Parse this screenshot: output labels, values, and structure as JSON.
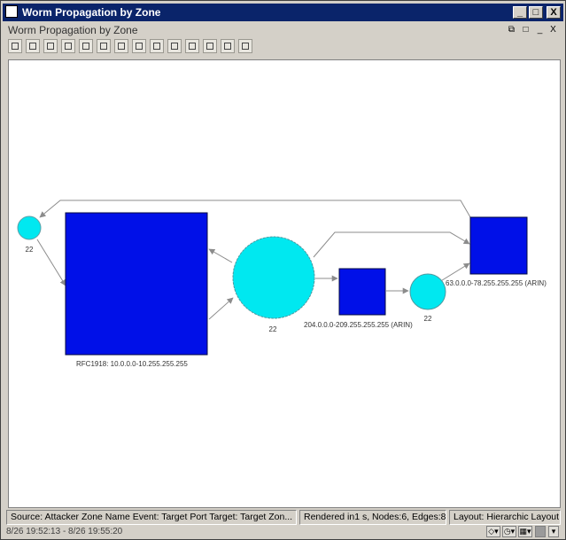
{
  "window": {
    "title": "Worm Propagation by Zone",
    "inner_title": "Worm Propagation by Zone",
    "minimize": "_",
    "maximize": "□",
    "close": "X"
  },
  "inner_controls": {
    "restore": "⧉",
    "max": "□",
    "min": "_",
    "close": "X"
  },
  "toolbar": {
    "icons": [
      "split-icon",
      "fit-icon",
      "zoom-in-icon",
      "zoom-out-icon",
      "layout-icon",
      "tree-icon",
      "radial-icon",
      "grid-icon",
      "hierarchy-icon",
      "export-icon",
      "image-icon",
      "print-icon",
      "stop-icon",
      "help-icon"
    ]
  },
  "graph": {
    "colors": {
      "zone": "#0010e8",
      "port": "#00e8f0",
      "edge": "#8c8c8c"
    },
    "labels": {
      "left_port": "22",
      "rfc1918": "RFC1918: 10.0.0.0-10.255.255.255",
      "center_port": "22",
      "arin204": "204.0.0.0-209.255.255.255 (ARIN)",
      "right_port": "22",
      "arin63": "63.0.0.0-78.255.255.255 (ARIN)"
    }
  },
  "status": {
    "source": "Source: Attacker Zone Name Event: Target Port Target: Target Zon...",
    "rendered": "Rendered in1 s, Nodes:6, Edges:8",
    "layout": "Layout: Hierarchic Layout"
  },
  "time": {
    "range": "8/26 19:52:13 - 8/26 19:55:20",
    "controls": [
      "◇▾",
      "◷▾",
      "▦▾",
      "",
      "▾"
    ]
  }
}
